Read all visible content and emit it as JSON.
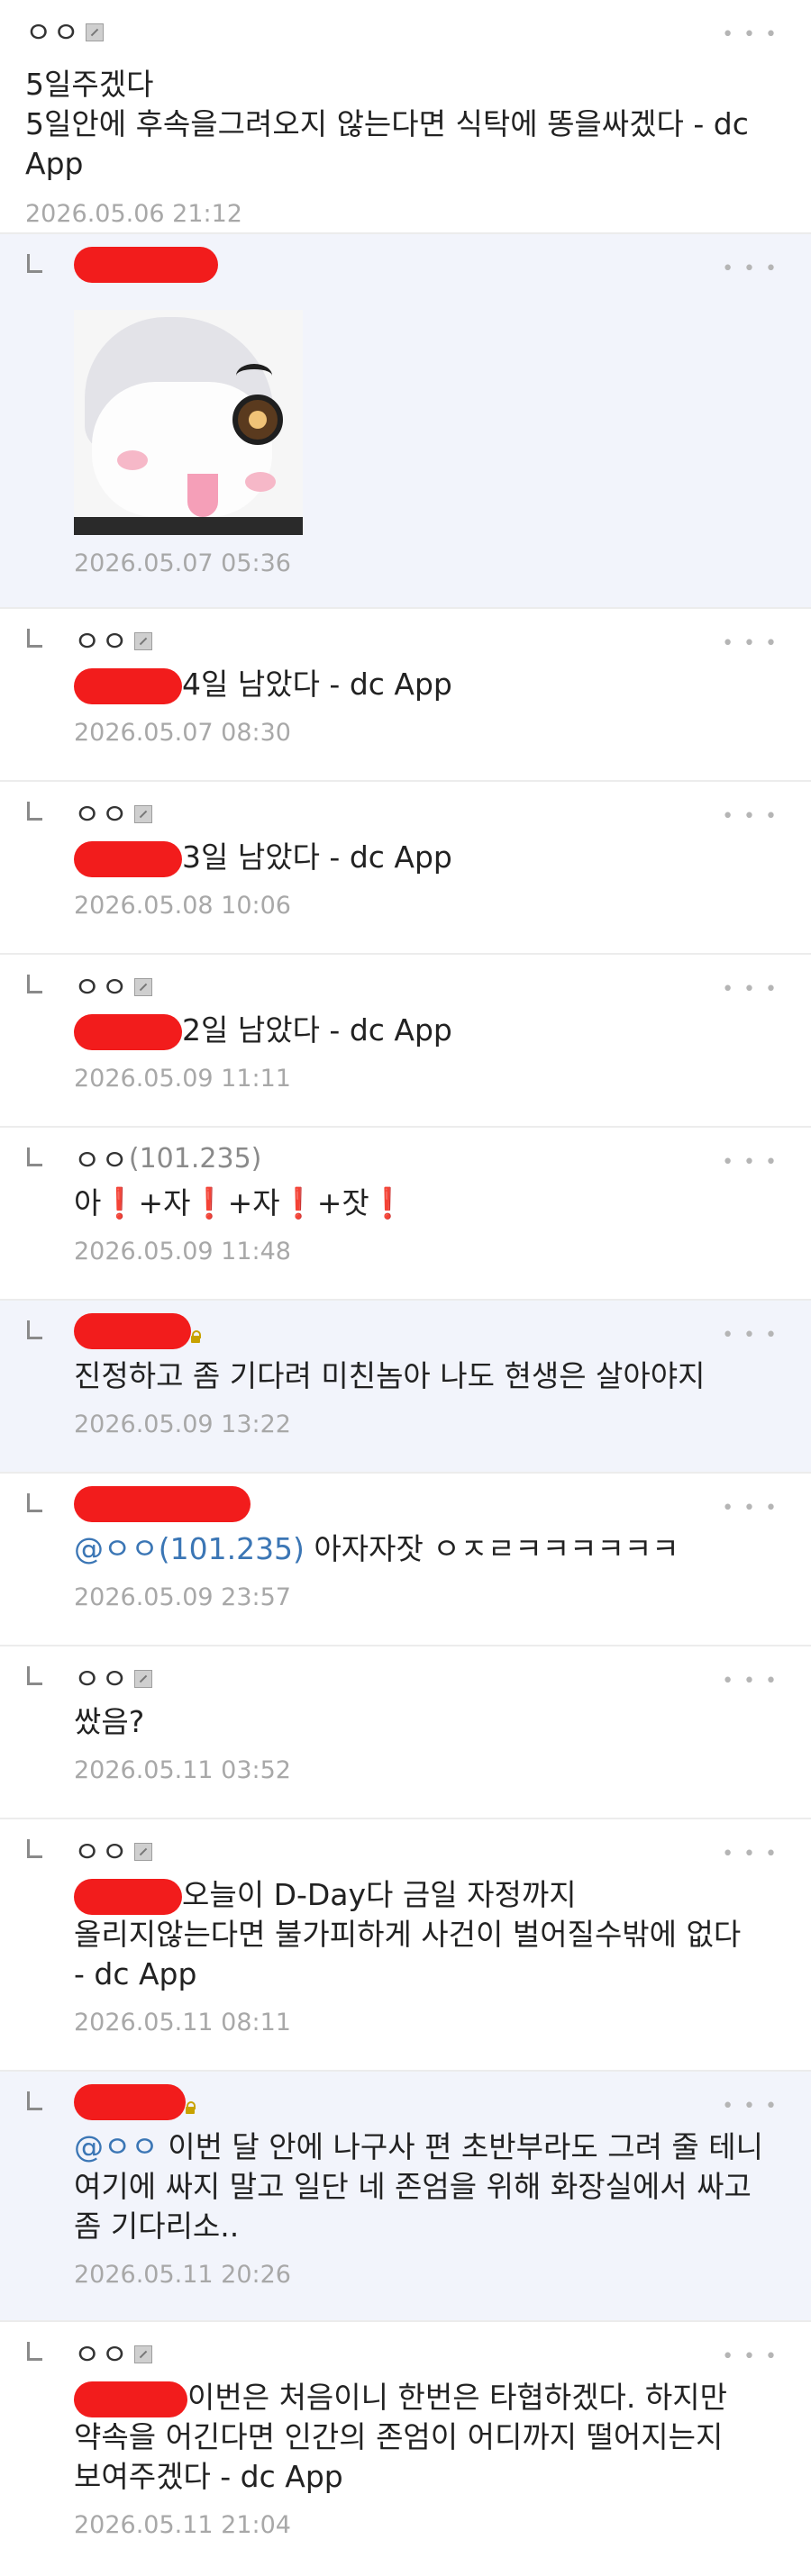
{
  "comments": [
    {
      "nick": "ㅇㅇ",
      "title": "5일주겠다",
      "body": "5일안에 후속을그려오지 않는다면 식탁에 똥을싸겠다 - dc App",
      "time": "2026.05.06 21:12"
    },
    {
      "time": "2026.05.07 05:36"
    },
    {
      "nick": "ㅇㅇ",
      "body": "4일 남았다 - dc App",
      "time": "2026.05.07 08:30"
    },
    {
      "nick": "ㅇㅇ",
      "body": "3일 남았다 - dc App",
      "time": "2026.05.08 10:06"
    },
    {
      "nick": "ㅇㅇ",
      "body": "2일 남았다 - dc App",
      "time": "2026.05.09 11:11"
    },
    {
      "nick": "ㅇㅇ",
      "ip": "(101.235)",
      "body_parts": [
        "아",
        "❗",
        "+자",
        "❗",
        "+자",
        "❗",
        "+잣",
        "❗"
      ],
      "time": "2026.05.09 11:48"
    },
    {
      "body": "진정하고 좀 기다려 미친놈아 나도 현생은 살아야지",
      "time": "2026.05.09 13:22"
    },
    {
      "mention": "@ㅇㅇ(101.235)",
      "body": " 아자자잣 ㅇㅈㄹㅋㅋㅋㅋㅋㅋ",
      "time": "2026.05.09 23:57"
    },
    {
      "nick": "ㅇㅇ",
      "body": "쌌음?",
      "time": "2026.05.11 03:52"
    },
    {
      "nick": "ㅇㅇ",
      "body_line1": "오늘이 D-Day다 금일 자정까지",
      "body_line2": "올리지않는다면 불가피하게 사건이 벌어질수밖에 없다",
      "body_line3": "- dc App",
      "time": "2026.05.11 08:11"
    },
    {
      "mention": "@ㅇㅇ",
      "body_line1": " 이번 달 안에 나구사 편 초반부라도 그려 줄 테니",
      "body_line2": "여기에 싸지 말고 일단 네 존엄을 위해 화장실에서 싸고",
      "body_line3": "좀 기다리소..",
      "time": "2026.05.11 20:26"
    },
    {
      "nick": "ㅇㅇ",
      "body_line1": "이번은 처음이니 한번은 타협하겠다. 하지만",
      "body_line2": "약속을 어긴다면 인간의 존엄이 어디까지 떨어지는지",
      "body_line3": "보여주겠다 - dc App",
      "time": "2026.05.11 21:04"
    }
  ],
  "colors": {
    "redaction": "#f21c1c",
    "mention": "#3b76b5",
    "timestamp": "#a8a8a8",
    "highlight_bg": "#f2f4fb"
  },
  "icons": [
    "reply-bracket-icon",
    "more-options-icon",
    "member-badge-icon",
    "lock-icon"
  ]
}
